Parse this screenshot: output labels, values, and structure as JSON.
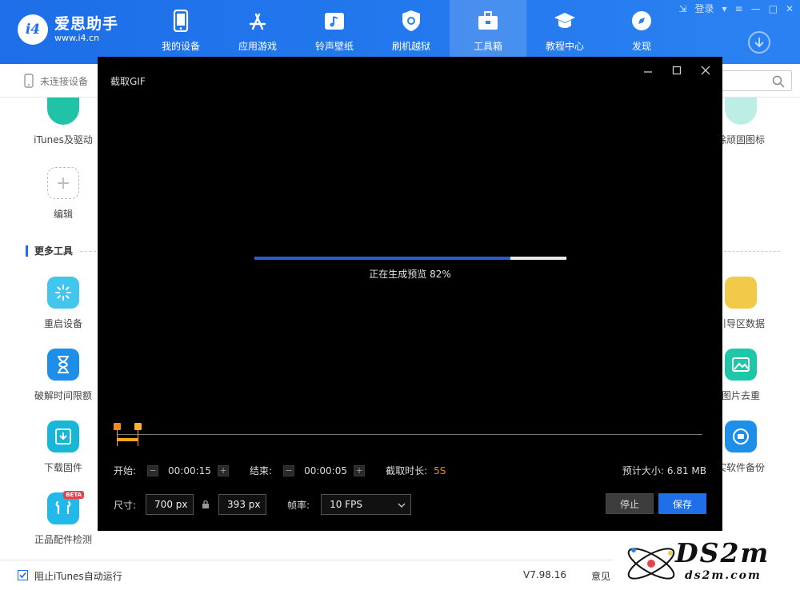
{
  "app": {
    "name": "爱思助手",
    "url": "www.i4.cn",
    "logo_badge": "i4",
    "brand_color": "#1d6ee8",
    "login": "登录"
  },
  "nav": [
    {
      "label": "我的设备",
      "icon": "phone-icon"
    },
    {
      "label": "应用游戏",
      "icon": "app-store-icon"
    },
    {
      "label": "铃声壁纸",
      "icon": "music-icon"
    },
    {
      "label": "刷机越狱",
      "icon": "shield-icon"
    },
    {
      "label": "工具箱",
      "icon": "toolbox-icon",
      "active": true
    },
    {
      "label": "教程中心",
      "icon": "graduation-cap-icon"
    },
    {
      "label": "发现",
      "icon": "compass-icon"
    }
  ],
  "subbar": {
    "device_status": "未连接设备"
  },
  "left_tools": [
    {
      "label": "iTunes及驱动",
      "color": "#21c3a6"
    },
    {
      "label": "编辑",
      "color": "#ffffff"
    },
    {
      "label": "重启设备",
      "color": "#42c6ee"
    },
    {
      "label": "破解时间限额",
      "color": "#1d8fe8"
    },
    {
      "label": "下载固件",
      "color": "#18b7d8"
    },
    {
      "label": "正品配件检测",
      "color": "#21b9ea",
      "badge": "BETA"
    }
  ],
  "right_tools": [
    {
      "label": "除顽固图标",
      "color": "#bdeee6"
    },
    {
      "label": "引导区数据",
      "color": "#f3c94a"
    },
    {
      "label": "图片去重",
      "color": "#1ec7a8"
    },
    {
      "label": "实软件备份",
      "color": "#1d8fe8"
    }
  ],
  "section_title": "更多工具",
  "bottom": {
    "checkbox_label": "阻止iTunes自动运行",
    "version": "V7.98.16",
    "feedback": "意见"
  },
  "watermark": {
    "big": "DS2m",
    "small": "ds2m.com"
  },
  "dialog": {
    "title": "截取GIF",
    "progress_percent": 82,
    "progress_text": "正在生成预览 82%",
    "start_label": "开始:",
    "start_value": "00:00:15",
    "end_label": "结束:",
    "end_value": "00:00:05",
    "duration_label": "截取时长:",
    "duration_value": "5S",
    "estimate_label": "预计大小:",
    "estimate_value": "6.81 MB",
    "size_label": "尺寸:",
    "width_value": "700 px",
    "height_value": "393 px",
    "fps_label": "帧率:",
    "fps_value": "10 FPS",
    "stop_label": "停止",
    "save_label": "保存",
    "minus": "−",
    "plus": "+"
  }
}
